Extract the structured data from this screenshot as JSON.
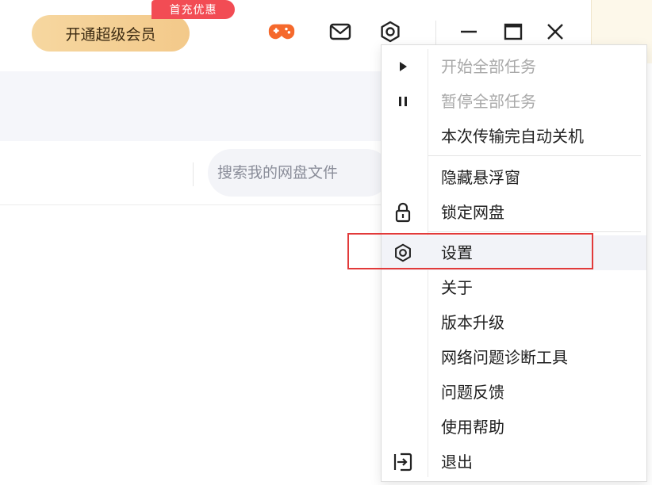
{
  "topbar": {
    "vip_button_label": "开通超级会员",
    "vip_badge": "首充优惠",
    "icons": [
      "gamepad-icon",
      "mail-icon",
      "settings-icon",
      "minimize-icon",
      "maximize-icon",
      "close-icon"
    ],
    "accent_color": "#f24c54",
    "vip_color": "#f3c98a",
    "game_icon_color": "#f5692c"
  },
  "search": {
    "placeholder": "搜索我的网盘文件"
  },
  "menu": {
    "items": [
      {
        "label": "开始全部任务",
        "icon": "play-icon",
        "disabled": true
      },
      {
        "label": "暂停全部任务",
        "icon": "pause-icon",
        "disabled": true
      },
      {
        "label": "本次传输完自动关机",
        "icon": "",
        "disabled": false
      },
      {
        "label": "隐藏悬浮窗",
        "icon": "",
        "disabled": false
      },
      {
        "label": "锁定网盘",
        "icon": "lock-icon",
        "disabled": false
      },
      {
        "label": "设置",
        "icon": "settings-icon",
        "disabled": false,
        "highlighted": true
      },
      {
        "label": "关于",
        "icon": "",
        "disabled": false
      },
      {
        "label": "版本升级",
        "icon": "",
        "disabled": false
      },
      {
        "label": "网络问题诊断工具",
        "icon": "",
        "disabled": false
      },
      {
        "label": "问题反馈",
        "icon": "",
        "disabled": false
      },
      {
        "label": "使用帮助",
        "icon": "",
        "disabled": false
      },
      {
        "label": "退出",
        "icon": "exit-icon",
        "disabled": false
      }
    ],
    "highlight_color": "#e23a3a"
  }
}
